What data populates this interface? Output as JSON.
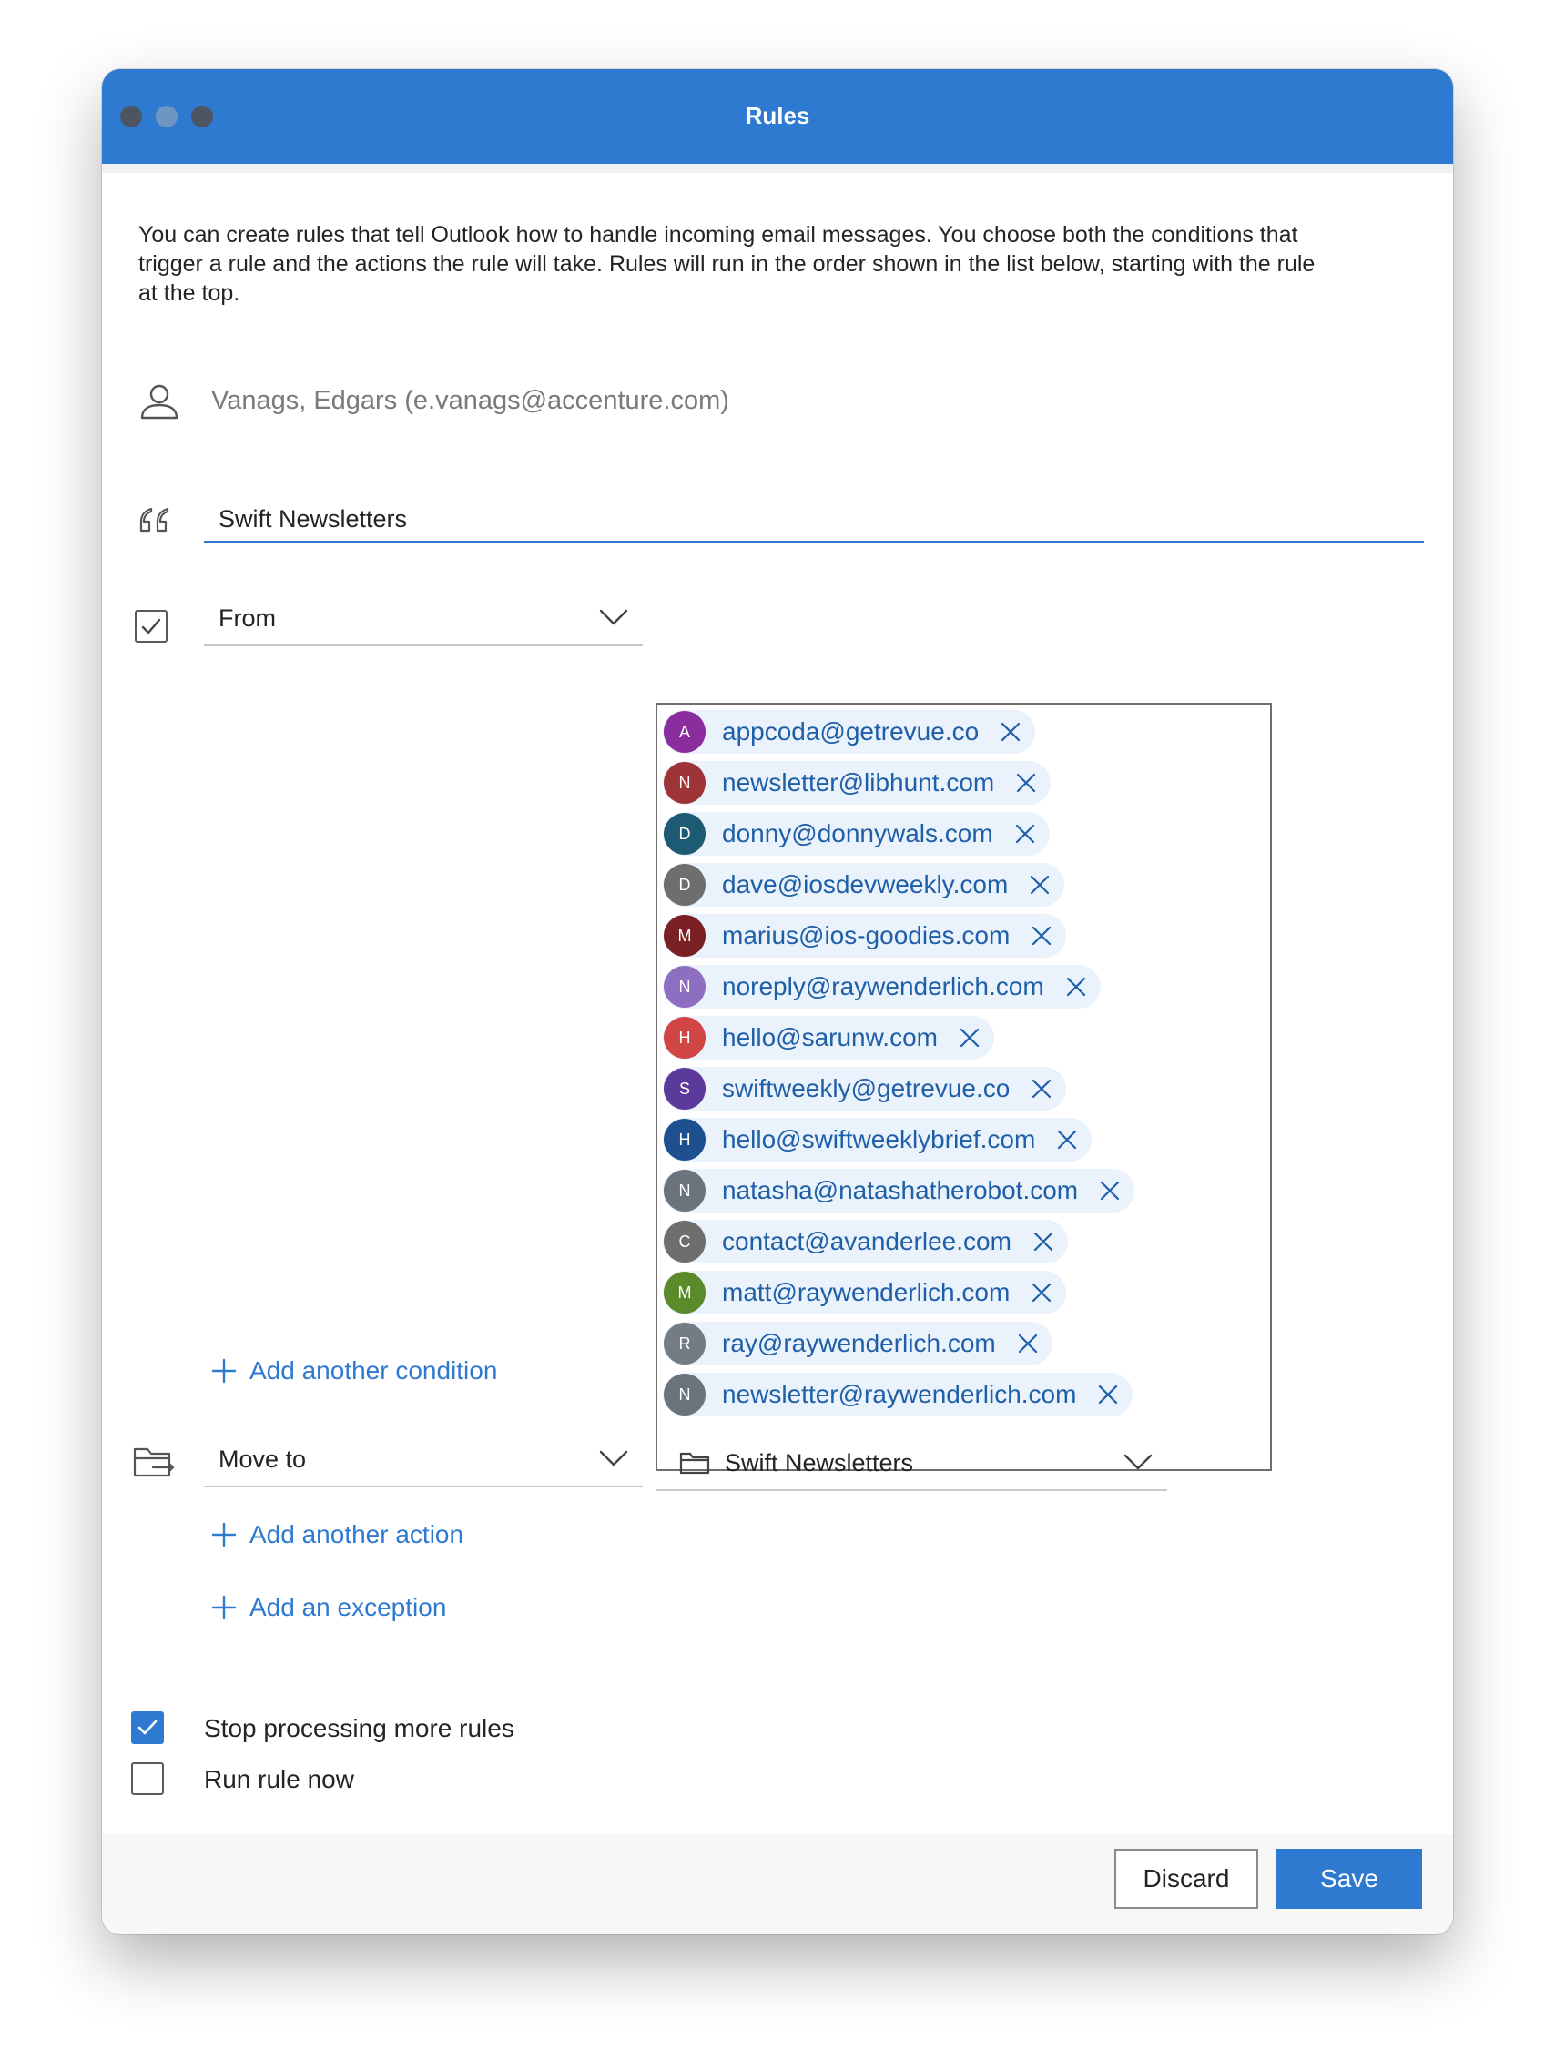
{
  "window": {
    "title": "Rules"
  },
  "intro": "You can create rules that tell Outlook how to handle incoming email messages. You choose both the conditions that trigger a rule and the actions the rule will take. Rules will run in the order shown in the list below, starting with the rule at the top.",
  "owner": "Vanags, Edgars (e.vanags@accenture.com)",
  "rule_name": {
    "value": "Swift Newsletters"
  },
  "condition": {
    "checked": true,
    "type": "From",
    "senders": [
      {
        "initial": "A",
        "email": "appcoda@getrevue.co",
        "color": "#8a2d9e"
      },
      {
        "initial": "N",
        "email": "newsletter@libhunt.com",
        "color": "#9e3437"
      },
      {
        "initial": "D",
        "email": "donny@donnywals.com",
        "color": "#1d5a73"
      },
      {
        "initial": "D",
        "email": "dave@iosdevweekly.com",
        "color": "#6e6e6e"
      },
      {
        "initial": "M",
        "email": "marius@ios-goodies.com",
        "color": "#7a1f22"
      },
      {
        "initial": "N",
        "email": "noreply@raywenderlich.com",
        "color": "#8e6ec1"
      },
      {
        "initial": "H",
        "email": "hello@sarunw.com",
        "color": "#d14545"
      },
      {
        "initial": "S",
        "email": "swiftweekly@getrevue.co",
        "color": "#5b3a9b"
      },
      {
        "initial": "H",
        "email": "hello@swiftweeklybrief.com",
        "color": "#1e4f8f"
      },
      {
        "initial": "N",
        "email": "natasha@natashatherobot.com",
        "color": "#6b737c"
      },
      {
        "initial": "C",
        "email": "contact@avanderlee.com",
        "color": "#6e6e6e"
      },
      {
        "initial": "M",
        "email": "matt@raywenderlich.com",
        "color": "#5a8a2a"
      },
      {
        "initial": "R",
        "email": "ray@raywenderlich.com",
        "color": "#737b83"
      },
      {
        "initial": "N",
        "email": "newsletter@raywenderlich.com",
        "color": "#6b737c"
      }
    ],
    "add_label": "Add another condition"
  },
  "action": {
    "type": "Move to",
    "folder": "Swift Newsletters",
    "add_label": "Add another action"
  },
  "exception_label": "Add an exception",
  "options": {
    "stop_processing": {
      "label": "Stop processing more rules",
      "checked": true
    },
    "run_now": {
      "label": "Run rule now",
      "checked": false
    }
  },
  "buttons": {
    "discard": "Discard",
    "save": "Save"
  },
  "colors": {
    "accent": "#2f7ad1",
    "link": "#2f7ad1",
    "chip_bg": "#eaf2fb"
  }
}
